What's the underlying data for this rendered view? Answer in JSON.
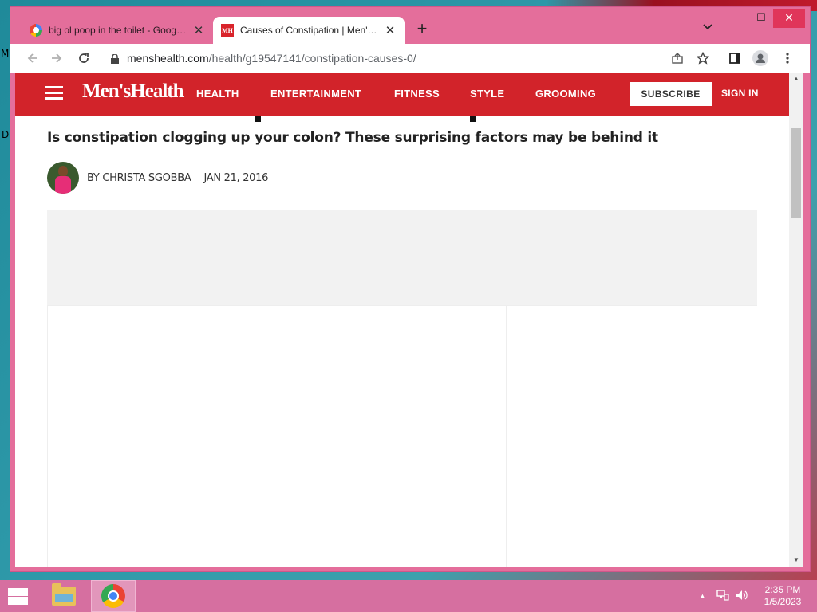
{
  "browser": {
    "tabs": [
      {
        "title": "big ol poop in the toilet - Google Search",
        "icon": "google-icon"
      },
      {
        "title": "Causes of Constipation | Men's Health",
        "icon": "menshealth-icon"
      }
    ],
    "url_host": "menshealth.com",
    "url_path": "/health/g19547141/constipation-causes-0/",
    "colors": {
      "frame": "#e46e9b",
      "close_button": "#e0355a"
    }
  },
  "site": {
    "logo": "Men'sHealth",
    "nav": [
      "HEALTH",
      "ENTERTAINMENT",
      "FITNESS",
      "STYLE",
      "GROOMING"
    ],
    "subscribe_label": "SUBSCRIBE",
    "signin_label": "SIGN IN",
    "brand_color": "#d2232a"
  },
  "article": {
    "dek": "Is constipation clogging up your colon? These surprising factors may be behind it",
    "by_prefix": "BY",
    "author": "CHRISTA SGOBBA",
    "date": "JAN 21, 2016"
  },
  "taskbar": {
    "time": "2:35 PM",
    "date": "1/5/2023",
    "apps": [
      "file-explorer-icon",
      "chrome-icon"
    ]
  },
  "desktop": {
    "edge_letters": [
      "M",
      "D"
    ]
  }
}
